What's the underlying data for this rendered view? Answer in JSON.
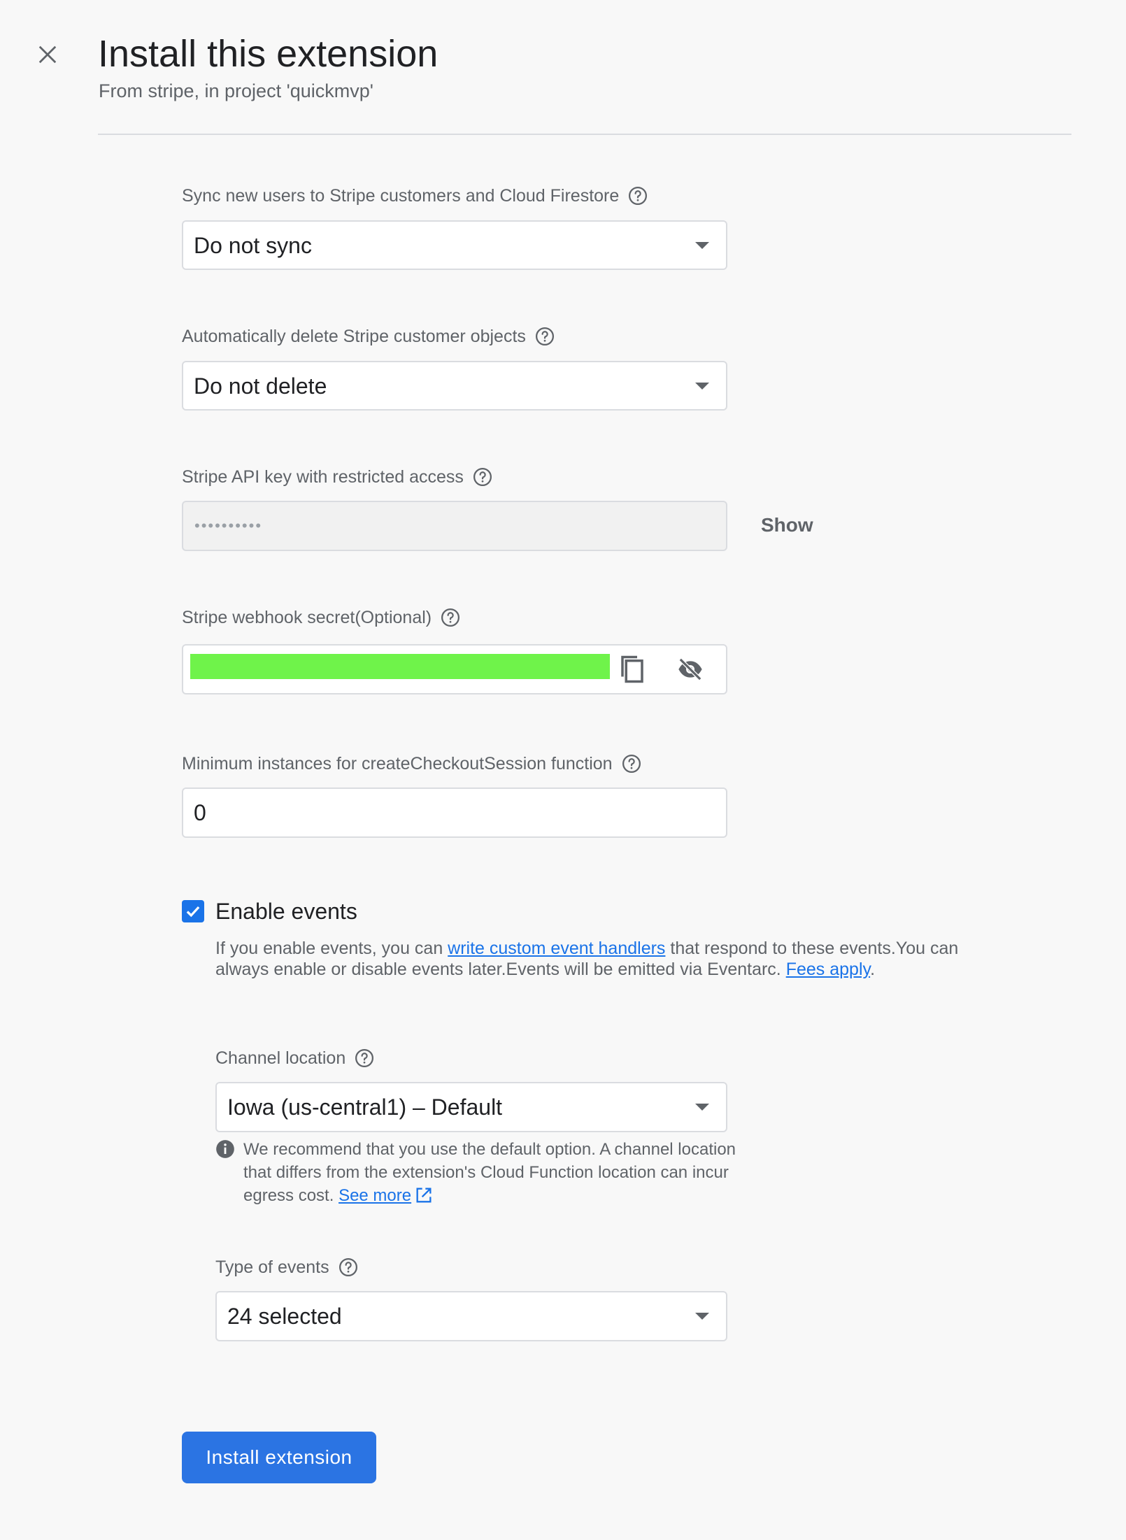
{
  "header": {
    "title": "Install this extension",
    "subtitle": "From stripe, in project 'quickmvp'"
  },
  "fields": {
    "sync_users": {
      "label": "Sync new users to Stripe customers and Cloud Firestore",
      "value": "Do not sync"
    },
    "delete_customers": {
      "label": "Automatically delete Stripe customer objects",
      "value": "Do not delete"
    },
    "api_key": {
      "label": "Stripe API key with restricted access",
      "masked_value": "••••••••••",
      "show_label": "Show"
    },
    "webhook_secret": {
      "label": "Stripe webhook secret(Optional)"
    },
    "min_instances": {
      "label": "Minimum instances for createCheckoutSession function",
      "value": "0"
    }
  },
  "events": {
    "checkbox_label": "Enable events",
    "checked": true,
    "description_prefix": "If you enable events, you can ",
    "link_custom_handlers": "write custom event handlers",
    "description_middle": " that respond to these events.You can always enable or disable events later.Events will be emitted via Eventarc. ",
    "link_fees": "Fees apply",
    "description_suffix": ".",
    "channel_location": {
      "label": "Channel location",
      "value": "Iowa (us-central1) – Default",
      "hint": "We recommend that you use the default option. A channel location that differs from the extension's Cloud Function location can incur egress cost. ",
      "see_more": "See more"
    },
    "type_of_events": {
      "label": "Type of events",
      "value": "24 selected"
    }
  },
  "actions": {
    "install_label": "Install extension"
  },
  "colors": {
    "accent": "#1a73e8",
    "button": "#2b74e3",
    "secret_redaction": "#6ff34a"
  },
  "icons": [
    "close-icon",
    "help-icon",
    "chevron-down-icon",
    "copy-icon",
    "visibility-off-icon",
    "check-icon",
    "info-icon",
    "open-in-new-icon"
  ]
}
